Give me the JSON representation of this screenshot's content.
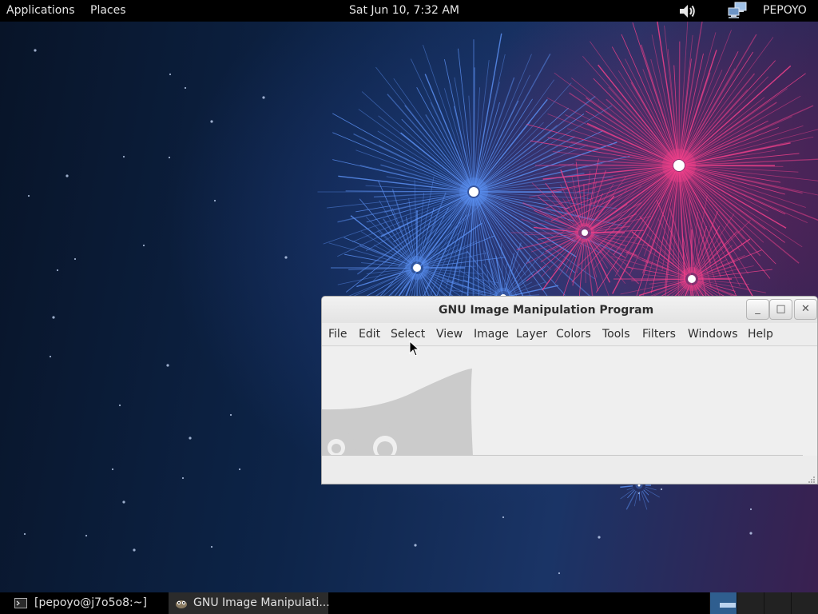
{
  "top_panel": {
    "applications_label": "Applications",
    "places_label": "Places",
    "clock": "Sat Jun 10,  7:32 AM",
    "user_name": "PEPOYO",
    "icons": [
      "volume-icon",
      "network-icon"
    ]
  },
  "gimp_window": {
    "title": "GNU Image Manipulation Program",
    "buttons": {
      "minimize": "_",
      "maximize": "□",
      "close": "✕"
    },
    "menu": [
      "File",
      "Edit",
      "Select",
      "View",
      "Image",
      "Layer",
      "Colors",
      "Tools",
      "Filters",
      "Windows",
      "Help"
    ]
  },
  "taskbar": {
    "tasks": [
      {
        "label": "[pepoyo@j7o5o8:~]",
        "icon": "terminal-icon"
      },
      {
        "label": "GNU Image Manipulati...",
        "icon": "gimp-icon"
      }
    ],
    "workspaces": [
      "workspace-1",
      "workspace-2",
      "workspace-3",
      "workspace-4"
    ],
    "active_workspace": 1
  },
  "colors": {
    "panel": "#000000",
    "wallpaper_dark": "#0c1a35",
    "firework_blue": "#5a8ef0",
    "firework_pink": "#f0408a",
    "window_bg": "#ededed",
    "active_workspace": "#2f5e8f"
  }
}
